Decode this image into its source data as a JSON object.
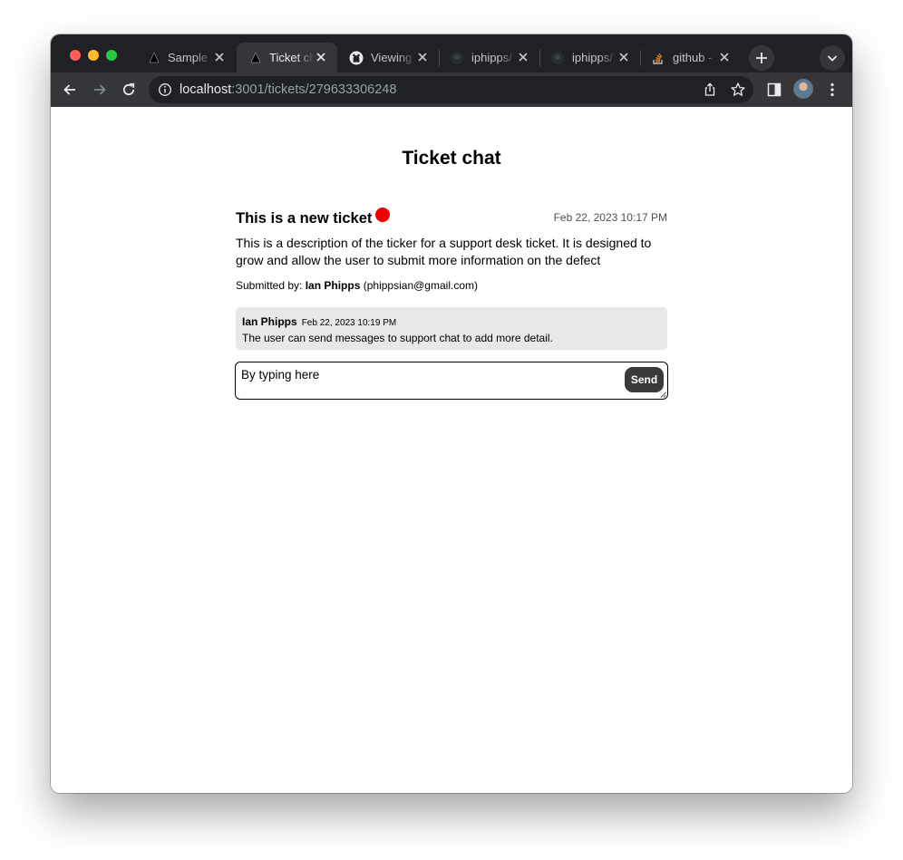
{
  "browser": {
    "tabs": [
      {
        "title": "Sample Next.js Project",
        "favicon": "vercel-triangle-icon",
        "active": false
      },
      {
        "title": "Ticket chat",
        "favicon": "vercel-triangle-icon",
        "active": true
      },
      {
        "title": "Viewing",
        "favicon": "github-icon",
        "active": false
      },
      {
        "title": "iphipps/",
        "favicon": "github-avatar-icon",
        "active": false
      },
      {
        "title": "iphipps/",
        "favicon": "github-avatar-icon",
        "active": false
      },
      {
        "title": "github -",
        "favicon": "stackoverflow-icon",
        "active": false
      }
    ],
    "url_host": "localhost",
    "url_rest": ":3001/tickets/279633306248",
    "colors": {
      "frame": "#202124",
      "toolbar": "#35363a",
      "omnibox": "#202124"
    }
  },
  "page": {
    "title": "Ticket chat",
    "ticket": {
      "title": "This is a new ticket",
      "status_color": "#ee0000",
      "date": "Feb 22, 2023 10:17 PM",
      "description": "This is a description of the ticker for a support desk ticket. It is designed to grow and allow the user to submit more information on the defect",
      "submitted_label": "Submitted by:",
      "submitted_name": "Ian Phipps",
      "submitted_email": "(phippsian@gmail.com)"
    },
    "messages": [
      {
        "author": "Ian Phipps",
        "time": "Feb 22, 2023 10:19 PM",
        "body": "The user can send messages to support chat to add more detail."
      }
    ],
    "composer": {
      "value": "By typing here",
      "send_label": "Send"
    }
  }
}
